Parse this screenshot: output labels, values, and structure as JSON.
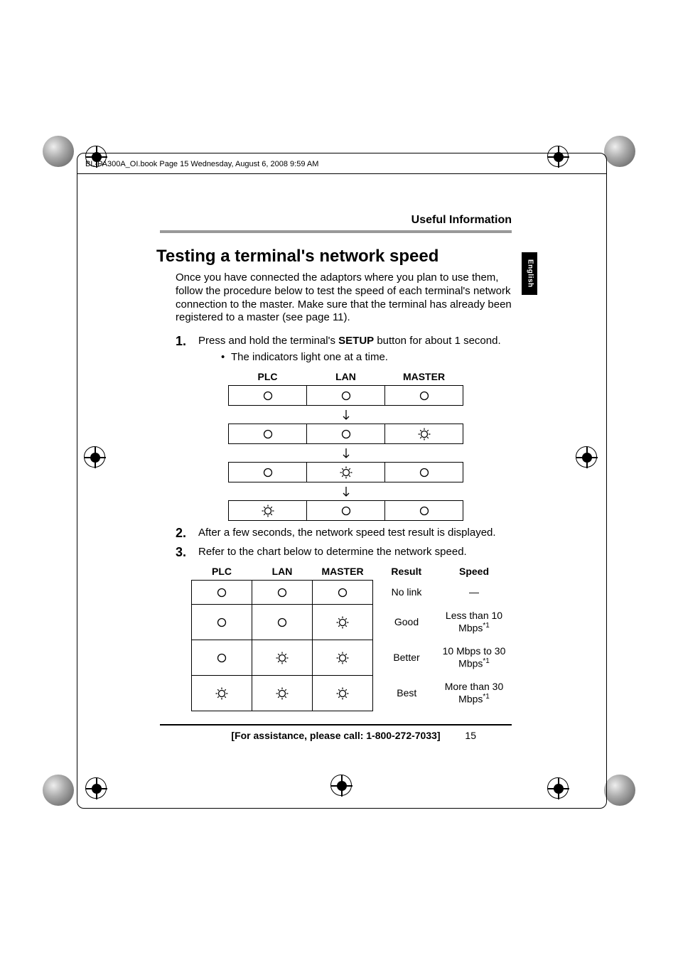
{
  "book_meta": "BL-PA300A_OI.book  Page 15  Wednesday, August 6, 2008  9:59 AM",
  "section_header": "Useful Information",
  "title": "Testing a terminal's network speed",
  "side_tab": "English",
  "intro": "Once you have connected the adaptors where you plan to use them, follow the procedure below to test the speed of each terminal's network connection to the master. Make sure that the terminal has already been registered to a master (see page 11).",
  "steps": {
    "s1_pre": "Press and hold the terminal's ",
    "s1_bold": "SETUP",
    "s1_post": " button for about 1 second.",
    "s1_bullet": "The indicators light one at a time.",
    "s2": "After a few seconds, the network speed test result is displayed.",
    "s3": "Refer to the chart below to determine the network speed."
  },
  "table1": {
    "headers": [
      "PLC",
      "LAN",
      "MASTER"
    ],
    "rows": [
      [
        "off",
        "off",
        "off"
      ],
      [
        "off",
        "off",
        "on"
      ],
      [
        "off",
        "on",
        "off"
      ],
      [
        "on",
        "off",
        "off"
      ]
    ]
  },
  "table2": {
    "headers": [
      "PLC",
      "LAN",
      "MASTER",
      "Result",
      "Speed"
    ],
    "rows": [
      {
        "ind": [
          "off",
          "off",
          "off"
        ],
        "result": "No link",
        "speed": "—",
        "fn": ""
      },
      {
        "ind": [
          "off",
          "off",
          "on"
        ],
        "result": "Good",
        "speed": "Less than 10 Mbps",
        "fn": "*1"
      },
      {
        "ind": [
          "off",
          "on",
          "on"
        ],
        "result": "Better",
        "speed": "10 Mbps to 30 Mbps",
        "fn": "*1"
      },
      {
        "ind": [
          "on",
          "on",
          "on"
        ],
        "result": "Best",
        "speed": "More than 30 Mbps",
        "fn": "*1"
      }
    ]
  },
  "footer": {
    "assist": "[For assistance, please call: 1-800-272-7033]",
    "page": "15"
  }
}
